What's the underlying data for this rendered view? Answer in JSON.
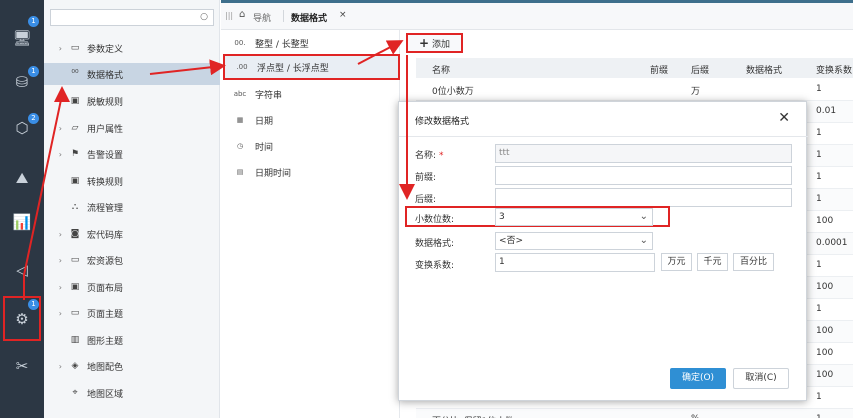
{
  "rail": {
    "badges": [
      "1",
      "1",
      "2",
      "1"
    ]
  },
  "tree": {
    "items": [
      {
        "label": "参数定义",
        "icon": "table-icon"
      },
      {
        "label": "数据格式",
        "icon": "format-icon"
      },
      {
        "label": "脱敏规则",
        "icon": "mask-icon"
      },
      {
        "label": "用户属性",
        "icon": "user-attr-icon"
      },
      {
        "label": "告警设置",
        "icon": "flag-icon"
      },
      {
        "label": "转换规则",
        "icon": "convert-icon"
      },
      {
        "label": "流程管理",
        "icon": "flow-icon"
      },
      {
        "label": "宏代码库",
        "icon": "macro-icon"
      },
      {
        "label": "宏资源包",
        "icon": "package-icon"
      },
      {
        "label": "页面布局",
        "icon": "layout-icon"
      },
      {
        "label": "页面主题",
        "icon": "theme-icon"
      },
      {
        "label": "图形主题",
        "icon": "chart-theme-icon"
      },
      {
        "label": "地图配色",
        "icon": "map-color-icon"
      },
      {
        "label": "地图区域",
        "icon": "map-pin-icon"
      }
    ]
  },
  "tabs": {
    "nav_label": "导航",
    "current_label": "数据格式",
    "close_glyph": "×"
  },
  "types": [
    {
      "icon_text": "00.",
      "label": "整型 / 长整型"
    },
    {
      "icon_text": ".00",
      "label": "浮点型 / 长浮点型"
    },
    {
      "icon_text": "abc",
      "label": "字符串"
    },
    {
      "icon_text": "▦",
      "label": "日期"
    },
    {
      "icon_text": "◷",
      "label": "时间"
    },
    {
      "icon_text": "▤",
      "label": "日期时间"
    }
  ],
  "content": {
    "add_label": "添加",
    "columns": [
      "名称",
      "前缀",
      "后缀",
      "数据格式",
      "变换系数"
    ],
    "rows": [
      {
        "name": "0位小数万",
        "prefix": "",
        "suffix": "万",
        "format": "",
        "factor": "1"
      },
      {
        "name": "",
        "prefix": "",
        "suffix": "",
        "format": "",
        "factor": "0.01"
      },
      {
        "name": "",
        "prefix": "",
        "suffix": "",
        "format": "",
        "factor": "1"
      },
      {
        "name": "",
        "prefix": "",
        "suffix": "",
        "format": "",
        "factor": "1"
      },
      {
        "name": "",
        "prefix": "",
        "suffix": "",
        "format": "",
        "factor": "1"
      },
      {
        "name": "",
        "prefix": "",
        "suffix": "",
        "format": "",
        "factor": "1"
      },
      {
        "name": "",
        "prefix": "",
        "suffix": "",
        "format": "",
        "factor": "100"
      },
      {
        "name": "",
        "prefix": "",
        "suffix": "",
        "format": "",
        "factor": "0.0001"
      },
      {
        "name": "",
        "prefix": "",
        "suffix": "",
        "format": "",
        "factor": "1"
      },
      {
        "name": "",
        "prefix": "",
        "suffix": "",
        "format": "",
        "factor": "100"
      },
      {
        "name": "",
        "prefix": "",
        "suffix": "",
        "format": "",
        "factor": "1"
      },
      {
        "name": "",
        "prefix": "",
        "suffix": "",
        "format": "",
        "factor": "100"
      },
      {
        "name": "",
        "prefix": "",
        "suffix": "",
        "format": "",
        "factor": "100"
      },
      {
        "name": "",
        "prefix": "",
        "suffix": "",
        "format": "",
        "factor": "100"
      },
      {
        "name": "",
        "prefix": "",
        "suffix": "",
        "format": "",
        "factor": "1"
      },
      {
        "name": "百分比_保留1位小数",
        "prefix": "",
        "suffix": "%",
        "format": "",
        "factor": "1"
      }
    ]
  },
  "modal": {
    "title": "修改数据格式",
    "close_glyph": "✕",
    "name_label": "名称:",
    "required_mark": "*",
    "name_value": "ttt",
    "prefix_label": "前缀:",
    "prefix_value": "",
    "suffix_label": "后缀:",
    "suffix_value": "",
    "decimals_label": "小数位数:",
    "decimals_value": "3",
    "format_label": "数据格式:",
    "format_value": "<否>",
    "factor_label": "变换系数:",
    "factor_value": "1",
    "unit_buttons": [
      "万元",
      "千元",
      "百分比"
    ],
    "ok_label": "确定(O)",
    "cancel_label": "取消(C)"
  },
  "colors": {
    "rail_bg": "#2c3744",
    "highlight_red": "#e02424",
    "primary_blue": "#2f8fd4"
  }
}
